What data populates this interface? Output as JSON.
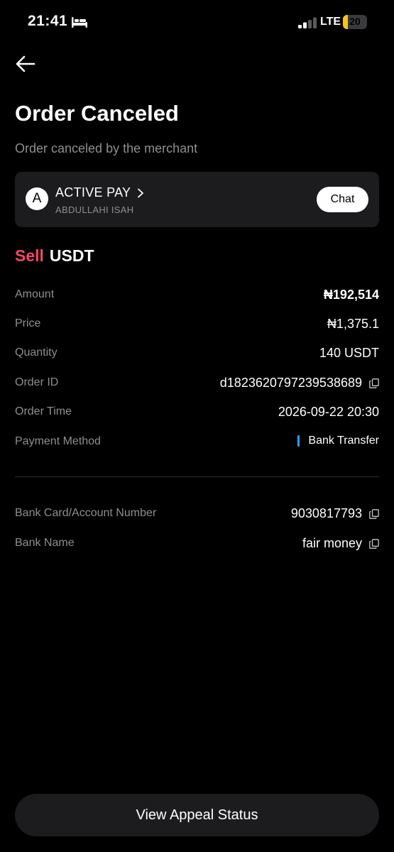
{
  "status_bar": {
    "time": "21:41",
    "network": "LTE",
    "battery_level": "20",
    "battery_fraction": 0.2,
    "battery_color": "#f5c518",
    "icons": [
      "bed-icon",
      "signal-icon",
      "battery-icon"
    ]
  },
  "header": {
    "back_icon": "arrow-left-icon",
    "title": "Order Canceled",
    "subtitle": "Order canceled by the merchant"
  },
  "merchant": {
    "avatar_letter": "A",
    "name": "ACTIVE PAY",
    "sub_name": "ABDULLAHI ISAH",
    "chat_label": "Chat"
  },
  "trade": {
    "side": "Sell",
    "asset": "USDT",
    "side_color": "#f6465d"
  },
  "details": {
    "amount_label": "Amount",
    "amount_value": "₦192,514",
    "price_label": "Price",
    "price_value": "₦1,375.1",
    "quantity_label": "Quantity",
    "quantity_value": "140 USDT",
    "order_id_label": "Order ID",
    "order_id_value": "d1823620797239538689",
    "order_time_label": "Order Time",
    "order_time_value": "2026-09-22 20:30",
    "payment_method_label": "Payment Method",
    "payment_method_value": "Bank Transfer",
    "payment_method_color": "#2f9bff"
  },
  "bank": {
    "account_label": "Bank Card/Account Number",
    "account_value": "9030817793",
    "bank_name_label": "Bank Name",
    "bank_name_value": "fair money"
  },
  "footer": {
    "appeal_label": "View Appeal Status"
  }
}
